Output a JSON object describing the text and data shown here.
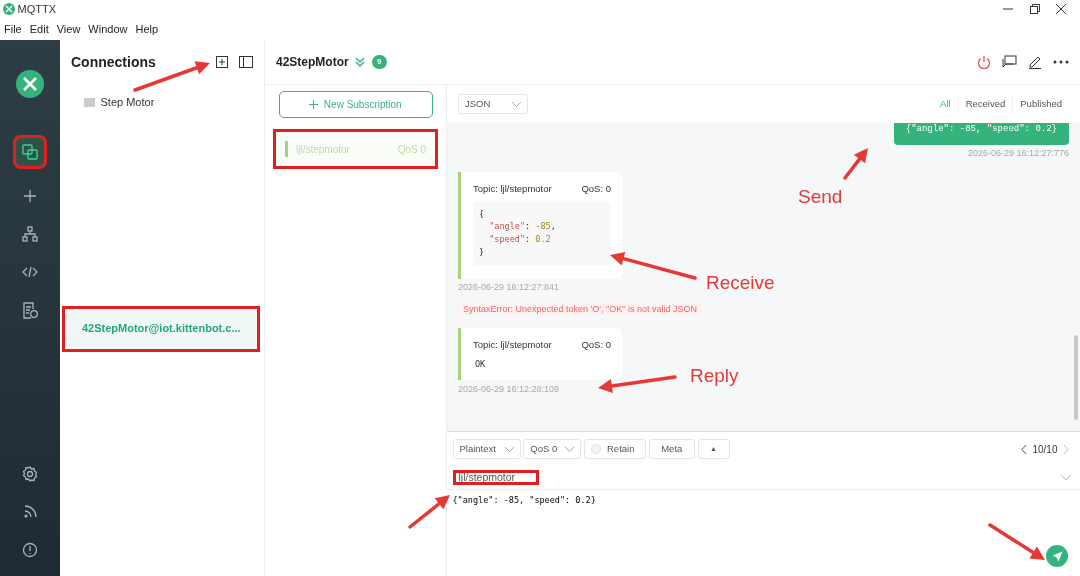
{
  "window": {
    "title": "MQTTX"
  },
  "menu": [
    "File",
    "Edit",
    "View",
    "Window",
    "Help"
  ],
  "nav": [
    {
      "kind": "connections",
      "selected": true,
      "annotated": true
    },
    {
      "kind": "new",
      "selected": false,
      "annotated": false
    },
    {
      "kind": "topology",
      "selected": false,
      "annotated": false
    },
    {
      "kind": "script",
      "selected": false,
      "annotated": false
    },
    {
      "kind": "log",
      "selected": false,
      "annotated": false
    }
  ],
  "nav_bottom": [
    {
      "kind": "settings"
    },
    {
      "kind": "feed"
    },
    {
      "kind": "about"
    }
  ],
  "connections": {
    "title": "Connections",
    "folders": [
      {
        "name": "Step Motor"
      }
    ],
    "items": [
      {
        "name": "42StepMotor@iot.kittenbot.c...",
        "selected": true,
        "annotated": true
      }
    ]
  },
  "header": {
    "title": "42StepMotor",
    "badge": "9"
  },
  "subscriptions": {
    "button": "New Subscription",
    "items": [
      {
        "topic": "ljl/stepmotor",
        "qos": "QoS 0",
        "color": "#a5d17a",
        "annotated": true
      }
    ]
  },
  "toolbar": {
    "format": "JSON",
    "tabs": [
      {
        "label": "All",
        "selected": true
      },
      {
        "label": "Received",
        "selected": false
      },
      {
        "label": "Published",
        "selected": false
      }
    ]
  },
  "messages": [
    {
      "kind": "sent",
      "payload": [
        "{\"angle\": -85, \"speed\": 0.2}"
      ],
      "time": "2026-06-29 16:12:27:776"
    },
    {
      "kind": "received",
      "topic": "Topic: ljl/stepmotor",
      "qos": "QoS: 0",
      "payload": [
        "{",
        "  \"angle\": -85,",
        "  \"speed\": 0.2",
        "}"
      ],
      "time": "2026-06-29 16:12:27:841"
    },
    {
      "kind": "error",
      "text": "SyntaxError: Unexpected token 'O', \"OK\" is not valid JSON"
    },
    {
      "kind": "received",
      "topic": "Topic: ljl/stepmotor",
      "qos": "QoS: 0",
      "payload": [
        "OK"
      ],
      "time": "2026-06-29 16:12:28:109"
    }
  ],
  "publish": {
    "format": "Plaintext",
    "qos": "QoS 0",
    "retain": {
      "label": "Retain",
      "checked": false
    },
    "meta": "Meta",
    "expand": "▲",
    "pager": "10/10",
    "topic": "ljl/stepmotor",
    "topic_annotated": true,
    "payload": "{\"angle\": -85, \"speed\": 0.2}"
  },
  "annotations": [
    "Send",
    "Receive",
    "Reply"
  ]
}
